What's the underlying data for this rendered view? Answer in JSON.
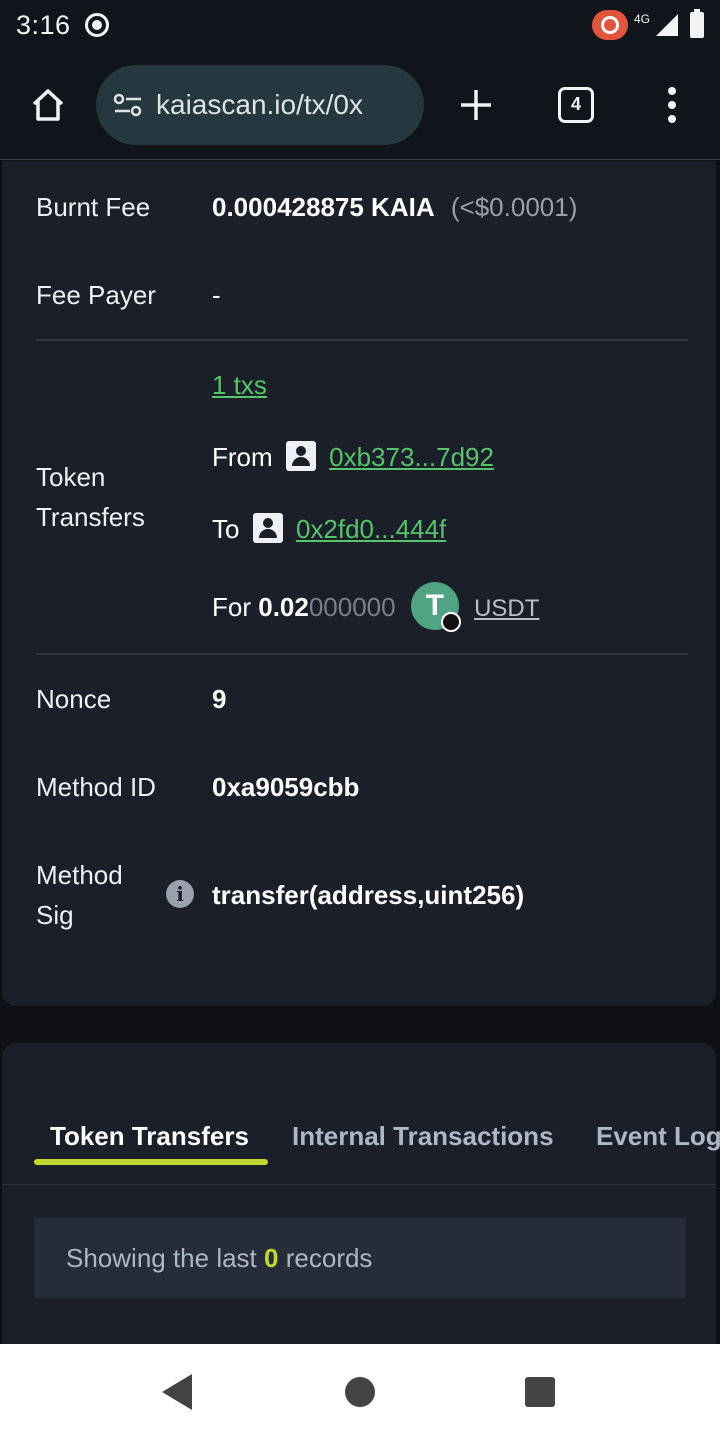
{
  "status_bar": {
    "time": "3:16",
    "network": "4G"
  },
  "browser": {
    "url": "kaiascan.io/tx/0x",
    "tab_count": "4"
  },
  "details": {
    "burnt_fee": {
      "label": "Burnt Fee",
      "value": "0.000428875 KAIA",
      "usd": "(<$0.0001)"
    },
    "fee_payer": {
      "label": "Fee Payer",
      "value": "-"
    },
    "token_transfers": {
      "label_line1": "Token",
      "label_line2": "Transfers",
      "txs_link": "1 txs",
      "from_label": "From",
      "from_address": "0xb373...7d92",
      "to_label": "To",
      "to_address": "0x2fd0...444f",
      "for_label": "For",
      "amount_main": "0.02",
      "amount_zeros": "000000",
      "token": "USDT"
    },
    "nonce": {
      "label": "Nonce",
      "value": "9"
    },
    "method_id": {
      "label": "Method ID",
      "value": "0xa9059cbb"
    },
    "method_sig": {
      "label_line1": "Method",
      "label_line2": "Sig",
      "value": "transfer(address,uint256)"
    }
  },
  "tabs": [
    {
      "label": "Token Transfers",
      "active": true
    },
    {
      "label": "Internal Transactions",
      "active": false
    },
    {
      "label": "Event Log",
      "active": false
    }
  ],
  "records": {
    "prefix": "Showing the last",
    "count": "0",
    "suffix": "records"
  },
  "colors": {
    "accent_green": "#58c46a",
    "accent_lime": "#c1d82f",
    "card_bg": "#1b1f29"
  }
}
